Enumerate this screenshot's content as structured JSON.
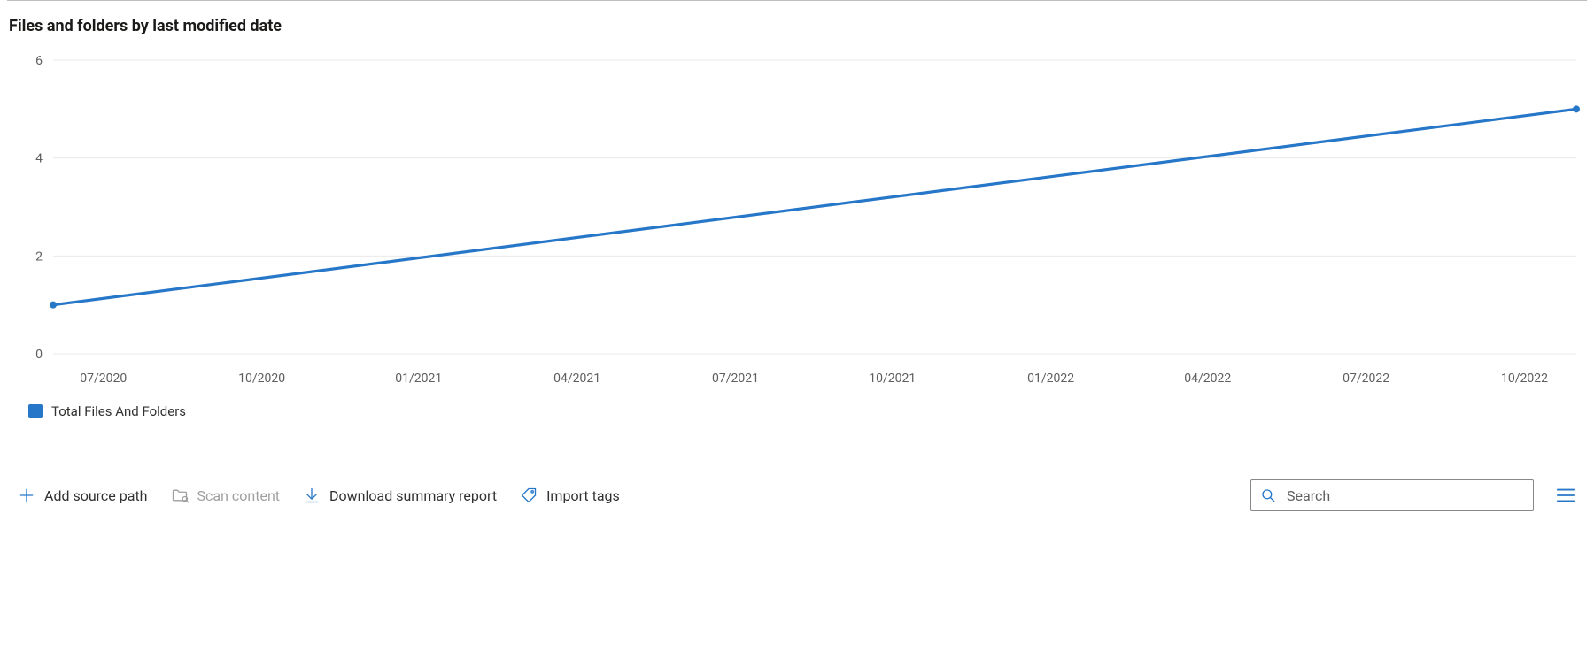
{
  "section": {
    "title": "Files and folders by last modified date"
  },
  "legend": {
    "series1_label": "Total Files And Folders",
    "series1_color": "#2777c9"
  },
  "toolbar": {
    "add_source_label": "Add source path",
    "scan_content_label": "Scan content",
    "download_report_label": "Download summary report",
    "import_tags_label": "Import tags",
    "search_placeholder": "Search"
  },
  "chart_data": {
    "type": "line",
    "title": "Files and folders by last modified date",
    "xlabel": "",
    "ylabel": "",
    "ylim": [
      0,
      6
    ],
    "y_ticks": [
      0,
      2,
      4,
      6
    ],
    "x_tick_labels": [
      "07/2020",
      "10/2020",
      "01/2021",
      "04/2021",
      "07/2021",
      "10/2021",
      "01/2022",
      "04/2022",
      "07/2022",
      "10/2022"
    ],
    "series": [
      {
        "name": "Total Files And Folders",
        "color": "#2777c9",
        "points": [
          {
            "x_label": "06/2020",
            "x_frac": 0.0,
            "y": 1.0
          },
          {
            "x_label": "12/2022",
            "x_frac": 1.0,
            "y": 5.0
          }
        ]
      }
    ],
    "x_tick_fracs": [
      0.033,
      0.137,
      0.24,
      0.344,
      0.448,
      0.551,
      0.655,
      0.758,
      0.862,
      0.966
    ]
  }
}
